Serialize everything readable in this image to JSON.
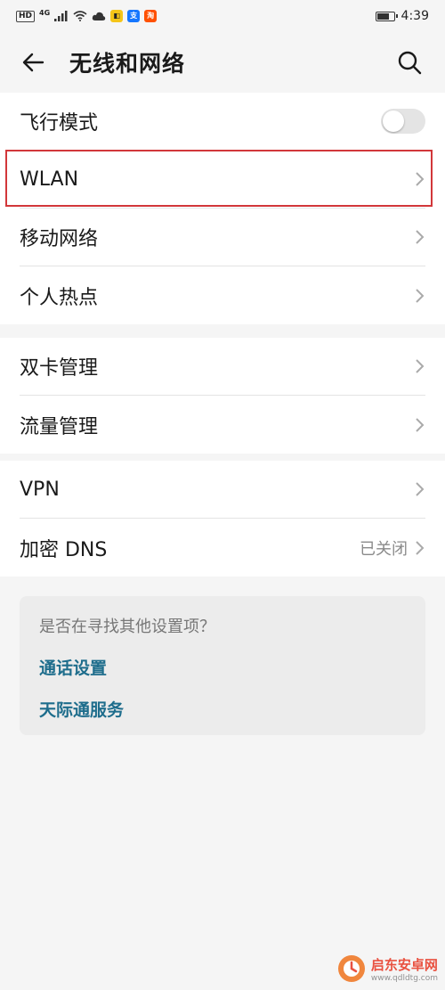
{
  "status_bar": {
    "hd": "HD",
    "network": "4G",
    "time": "4:39",
    "battery_level": 0.8
  },
  "header": {
    "title": "无线和网络"
  },
  "group1": [
    {
      "label": "飞行模式",
      "control": "toggle",
      "toggle_on": false
    },
    {
      "label": "WLAN",
      "control": "chevron",
      "highlighted": true
    },
    {
      "label": "移动网络",
      "control": "chevron"
    },
    {
      "label": "个人热点",
      "control": "chevron"
    }
  ],
  "group2": [
    {
      "label": "双卡管理",
      "control": "chevron"
    },
    {
      "label": "流量管理",
      "control": "chevron"
    }
  ],
  "group3": [
    {
      "label": "VPN",
      "control": "chevron"
    },
    {
      "label": "加密 DNS",
      "value": "已关闭",
      "control": "chevron"
    }
  ],
  "suggestions": {
    "question": "是否在寻找其他设置项？",
    "links": [
      "通话设置",
      "天际通服务"
    ]
  },
  "watermark": {
    "name": "启东安卓网",
    "url": "www.qdldtg.com"
  },
  "colors": {
    "highlight": "#d2373a",
    "link": "#1e6d8c",
    "background": "#f5f5f5",
    "watermark": "#e8402d"
  }
}
